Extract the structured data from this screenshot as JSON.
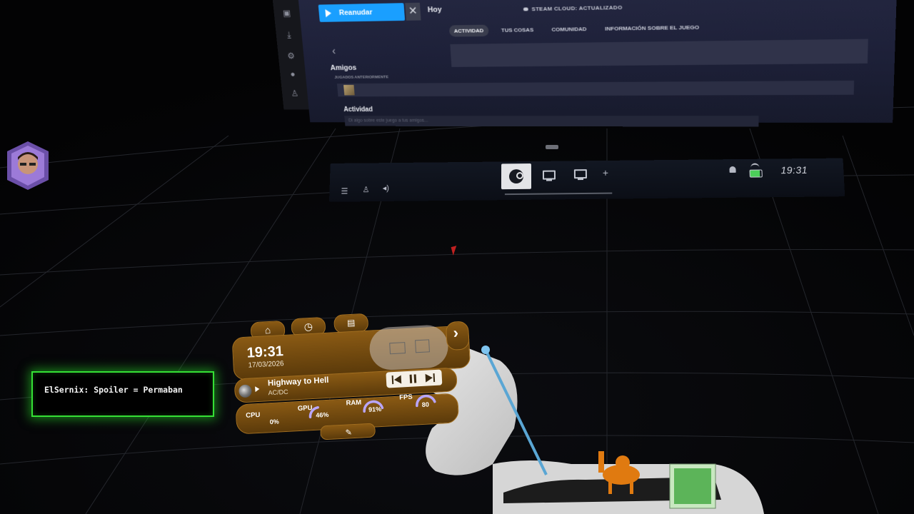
{
  "steam_panel": {
    "resume_label": "Reanudar",
    "close_glyph": "✕",
    "today_label": "Hoy",
    "cloud_status": "STEAM CLOUD: ACTUALIZADO",
    "tabs": [
      {
        "label": "ACTIVIDAD",
        "active": true
      },
      {
        "label": "TUS COSAS",
        "active": false
      },
      {
        "label": "COMUNIDAD",
        "active": false
      },
      {
        "label": "INFORMACIÓN SOBRE EL JUEGO",
        "active": false
      }
    ],
    "friends_heading": "Amigos",
    "previously_played": "JUGADOS ANTERIORMENTE",
    "activity_heading": "Actividad",
    "activity_placeholder": "Di algo sobre este juego a tus amigos...",
    "sidebar_icons": [
      "library-icon",
      "download-icon",
      "settings-icon",
      "controller-icon",
      "vr-icon"
    ]
  },
  "dashboard": {
    "time": "19:31",
    "left_icons": [
      "menu-icon",
      "vr-headset-icon",
      "volume-icon"
    ],
    "center_buttons": [
      "steam-logo-icon",
      "monitor-icon",
      "monitor-icon",
      "add-icon"
    ],
    "add_glyph": "+",
    "status_icons": [
      "bell-icon",
      "battery-icon"
    ],
    "battery_color": "#4cce5a"
  },
  "chat": {
    "message": "ElSernix: Spoiler = Permaban",
    "border_color": "#35e035"
  },
  "wrist_overlay": {
    "time": "19:31",
    "date": "17/03/2026",
    "nav_icons": [
      "home-icon",
      "clock-icon",
      "window-icon"
    ],
    "track": {
      "title": "Highway to Hell",
      "artist": "AC/DC"
    },
    "media_controls": [
      "previous-icon",
      "pause-icon",
      "next-icon"
    ],
    "stats": [
      {
        "label": "CPU",
        "value": "0%",
        "fraction": 0.0
      },
      {
        "label": "GPU",
        "value": "46%",
        "fraction": 0.46
      },
      {
        "label": "RAM",
        "value": "91%",
        "fraction": 0.91
      },
      {
        "label": "FPS",
        "value": "80",
        "fraction": 0.89
      }
    ],
    "gauge_color": "#b9a6ff",
    "accent_color": "#7a4d10",
    "expand_glyph": "›",
    "edit_glyph": "✎"
  }
}
